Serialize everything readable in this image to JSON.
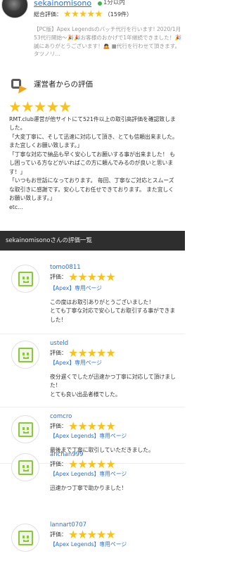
{
  "seller": {
    "name": "sekainomisono",
    "online_status": "1分以内",
    "rating_label": "総合評価：",
    "stars": "★★★★★",
    "rating_count": "（159件）",
    "description": "【PC版】Apex Legendsのバッチ代行を行います! 2020/1月 53代行開始〜🎉🎉お客様のおかげで1年継続できました！🎉 誠にありがとうございます！🙇 ■代行を行わせて頂きます。タツノリ…"
  },
  "operator": {
    "title": "運営者からの評価",
    "stars": "★★★★★",
    "paragraphs": [
      "RMT.club運営が他サイトにて521件以上の取引高評価を確認致しました。",
      "「大変丁寧に、そして迅速に対応して頂き、とても信頼出来ました。また宜しくお願い致します。」",
      "「丁寧な対応で納品も早く安心してお願いする事が出来ました！ もし困っている方などがいればこの方に頼んでみるのが良いと思います！」",
      "「いつもお世話になっております。 毎回、丁寧なご対応とスムーズな取引きに感謝です。安心してお任せできております。 また宜しくお願い致します。」",
      "etc..."
    ]
  },
  "review_list": {
    "title": "sekainomisonoさんの評価一覧",
    "rating_label": "評価：",
    "reviews": [
      {
        "name": "tomo0811",
        "stars": "★★★★★",
        "game": "【Apex】専用ページ",
        "comment": "この度はお取引ありがとうございました！\nとても丁寧な対応で安心してお取引する事ができました！"
      },
      {
        "name": "usteld",
        "stars": "★★★★★",
        "game": "【Apex】専用ページ",
        "comment": "夜分遅くでしたが迅速かつ丁寧に対応して頂けました！\nとても良い出品者様でした。"
      },
      {
        "name": "comcro",
        "stars": "★★★★★",
        "game": "【Apex Legends】専用ページ",
        "comment": "最後まで丁寧に取引していただきました。"
      },
      {
        "name": "anchan999",
        "stars": "★★★★★",
        "game": "【Apex Legends】専用ページ",
        "comment": "迅速かつ丁寧で助かりました！"
      },
      {
        "name": "lannart0707",
        "stars": "★★★★★",
        "game": "【Apex Legends】専用ページ",
        "comment": ""
      }
    ]
  },
  "colors": {
    "link": "#2a6fd6",
    "star": "#f6c21b",
    "online": "#3bb54a",
    "avatar_face": "#8cc63f",
    "list_header_bg": "#2e2e2e"
  },
  "icons": {
    "operator_logo": "rmt-club-logo-icon",
    "review_avatar": "smiley-face-icon",
    "online": "online-dot-icon"
  }
}
